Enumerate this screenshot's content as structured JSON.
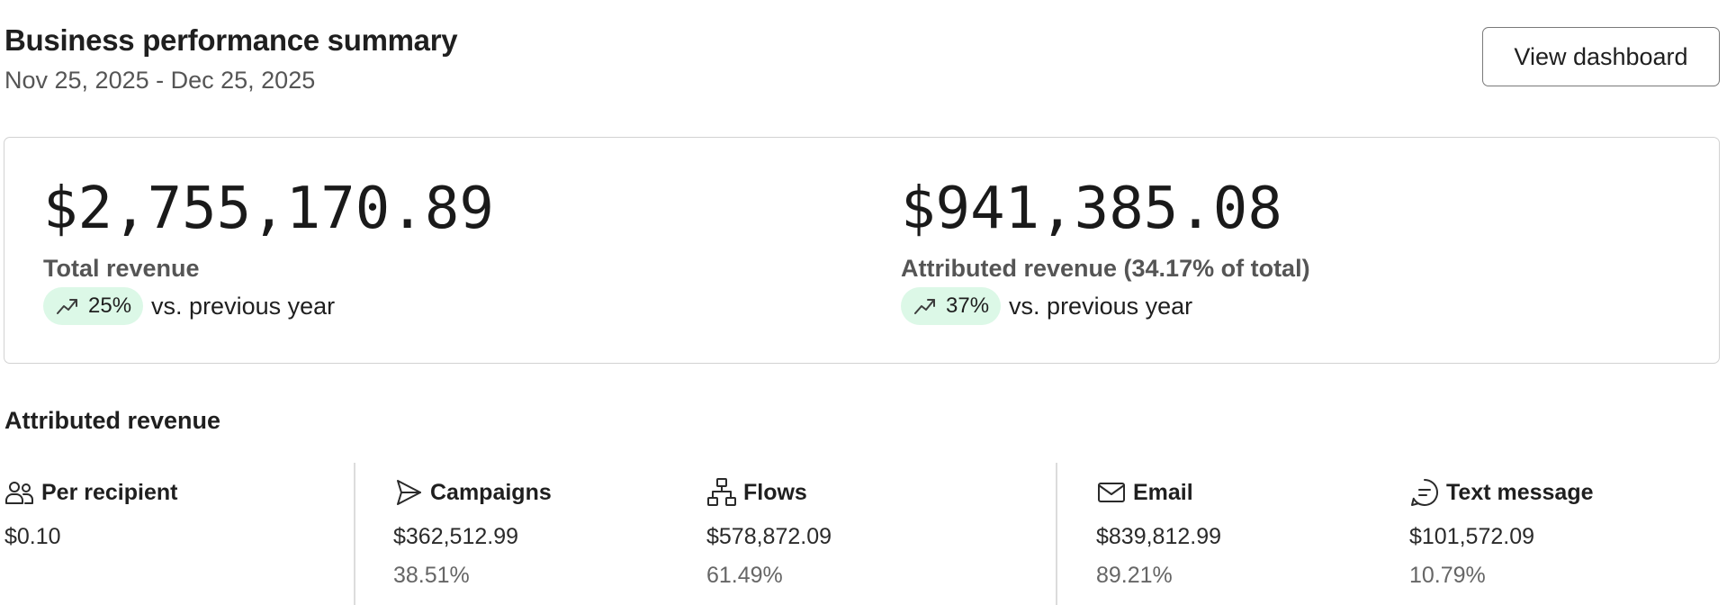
{
  "header": {
    "title": "Business performance summary",
    "date_range": "Nov 25, 2025 - Dec 25, 2025",
    "dashboard_button_label": "View dashboard"
  },
  "summary": {
    "total_revenue": {
      "value": "$2,755,170.89",
      "label": "Total revenue",
      "trend_percent": "25%",
      "trend_direction": "up",
      "trend_suffix": "vs. previous year"
    },
    "attributed_revenue": {
      "value": "$941,385.08",
      "label": "Attributed revenue (34.17% of total)",
      "trend_percent": "37%",
      "trend_direction": "up",
      "trend_suffix": "vs. previous year"
    }
  },
  "attributed": {
    "section_title": "Attributed revenue",
    "stats": [
      {
        "icon": "people-icon",
        "title": "Per recipient",
        "value": "$0.10",
        "percent": ""
      },
      {
        "icon": "send-icon",
        "title": "Campaigns",
        "value": "$362,512.99",
        "percent": "38.51%"
      },
      {
        "icon": "flows-icon",
        "title": "Flows",
        "value": "$578,872.09",
        "percent": "61.49%"
      },
      {
        "icon": "mail-icon",
        "title": "Email",
        "value": "$839,812.99",
        "percent": "89.21%"
      },
      {
        "icon": "chat-icon",
        "title": "Text message",
        "value": "$101,572.09",
        "percent": "10.79%"
      }
    ]
  },
  "colors": {
    "trend_pill_background": "#dcf8e7",
    "border": "#d2d2d2",
    "text_primary": "#1f1f1f",
    "text_secondary": "#555555"
  }
}
